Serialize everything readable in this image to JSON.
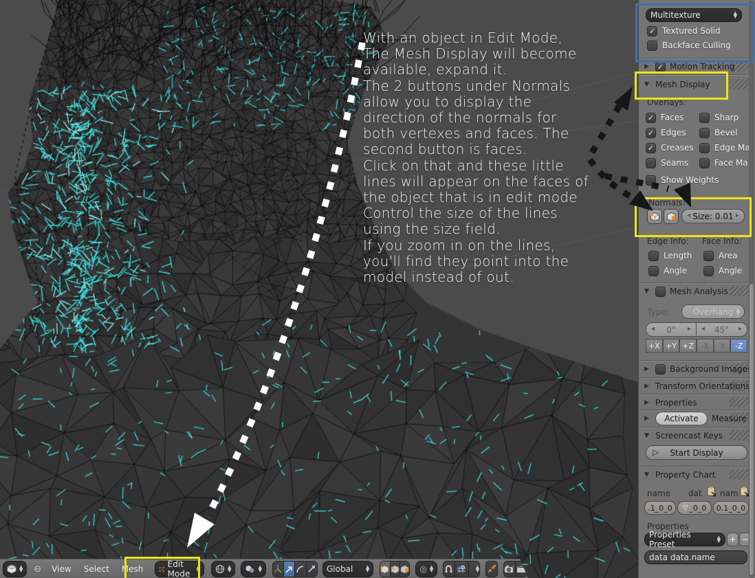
{
  "annotation": {
    "text": "With an object in Edit Mode,\nThe Mesh Display will become\navailable, expand it.\nThe 2 buttons under Normals\nallow you to display the\ndirection of the normals for\nboth vertexes and faces. The\nsecond button is faces.\nClick on that and these little\nlines will appear on the faces of\nthe object that is in edit mode\nControl the size of the lines\nusing the size field.\nIf you zoom in on the lines,\nyou'll find they point into the\nmodel instead of out."
  },
  "sidebar": {
    "shading": {
      "dropdown_value": "Multitexture",
      "textured_solid": {
        "label": "Textured Solid",
        "checked": true
      },
      "backface_culling": {
        "label": "Backface Culling",
        "checked": false
      }
    },
    "motion_tracking": {
      "title": "Motion Tracking",
      "checked": true
    },
    "mesh_display": {
      "title": "Mesh Display",
      "overlays_label": "Overlays:",
      "left_checks": [
        {
          "label": "Faces",
          "checked": true
        },
        {
          "label": "Edges",
          "checked": true
        },
        {
          "label": "Creases",
          "checked": true
        },
        {
          "label": "Seams",
          "checked": false
        }
      ],
      "right_checks": [
        {
          "label": "Sharp",
          "checked": false
        },
        {
          "label": "Bevel",
          "checked": false
        },
        {
          "label": "Edge Ma",
          "checked": false
        },
        {
          "label": "Face Ma",
          "checked": false
        }
      ],
      "show_weights": {
        "label": "Show Weights",
        "checked": false
      },
      "normals_label": "Normals:",
      "size_field": "Size: 0.01",
      "edge_info_label": "Edge Info:",
      "face_info_label": "Face Info:",
      "edge_checks": [
        {
          "label": "Length",
          "checked": false
        },
        {
          "label": "Angle",
          "checked": false
        }
      ],
      "face_checks": [
        {
          "label": "Area",
          "checked": false
        },
        {
          "label": "Angle",
          "checked": false
        }
      ]
    },
    "mesh_analysis": {
      "title": "Mesh Analysis",
      "checked": false,
      "type_label": "Type:",
      "type_value": "Overhang",
      "angle_min": "0°",
      "angle_max": "45°",
      "axis_buttons": [
        "+X",
        "+Y",
        "+Z",
        "-X",
        "-Y",
        "-Z"
      ],
      "active_axis": "-Z"
    },
    "background_images": {
      "title": "Background Images",
      "checked": false
    },
    "transform_orientations": {
      "title": "Transform Orientations"
    },
    "properties_panel": {
      "title": "Properties"
    },
    "measure": {
      "activate_button": "Activate",
      "title": "Measure"
    },
    "screencast_keys": {
      "title": "Screencast Keys",
      "start_button": "Start Display"
    },
    "property_chart": {
      "title": "Property Chart",
      "col1_label": "name",
      "col2_label": "dat",
      "col3_label": "nam",
      "field1": ".1_0_0",
      "field2": "_0_0",
      "field3": "0.1_0_0",
      "properties_label": "Properties",
      "preset_dropdown": "Properties Preset",
      "add_label": "+",
      "remove_label": "−",
      "data_field": "data data.name"
    }
  },
  "toolbar": {
    "menus": [
      "View",
      "Select",
      "Mesh"
    ],
    "mode_dropdown": "Edit Mode",
    "orientation_dropdown": "Global"
  },
  "colors": {
    "accent_cyan": "#3ee8e8",
    "highlight_yellow": "#f2e313",
    "highlight_blue": "#3f6fb0",
    "viewport_bg": "#4b4b4b",
    "sidebar_bg": "#747474"
  }
}
